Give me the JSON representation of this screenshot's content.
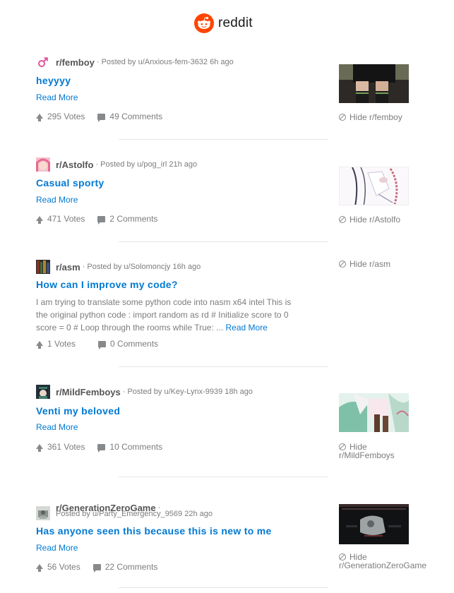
{
  "brand": {
    "name": "reddit",
    "icon": "reddit-alien-icon",
    "color": "#ff4500"
  },
  "posts": [
    {
      "subreddit": "r/femboy",
      "icon": "male-symbol-icon",
      "posted_by": "· Posted by u/Anxious-fem-3632 6h ago",
      "title": "heyyyy",
      "read_more": "Read More",
      "votes": "295 Votes",
      "comments": "49 Comments",
      "hide_label": "Hide r/femboy"
    },
    {
      "subreddit": "r/Astolfo",
      "icon": "astolfo-avatar-icon",
      "posted_by": "· Posted by u/pog_irl 21h ago",
      "title": "Casual sporty",
      "read_more": "Read More",
      "votes": "471 Votes",
      "comments": "2 Comments",
      "hide_label": "Hide r/Astolfo"
    },
    {
      "subreddit": "r/asm",
      "icon": "asm-avatar-icon",
      "posted_by": "· Posted by u/Solomoncjy 16h ago",
      "title": "How can I improve my code?",
      "excerpt": "I am trying to translate some python code into nasm x64 intel This is the original python code : import random as rd # Initialize score to 0 score = 0 # Loop through the rooms while True: ...",
      "read_more": "Read More",
      "votes": "1 Votes",
      "comments": "0 Comments",
      "hide_label": "Hide r/asm"
    },
    {
      "subreddit": "r/MildFemboys",
      "icon": "mildfemboys-avatar-icon",
      "posted_by": "· Posted by u/Key-Lynx-9939 18h ago",
      "title": "Venti my beloved",
      "read_more": "Read More",
      "votes": "361 Votes",
      "comments": "10 Comments",
      "hide_line1": "Hide",
      "hide_line2": "r/MildFemboys"
    },
    {
      "subreddit": "r/GenerationZeroGame",
      "icon": "generationzero-avatar-icon",
      "posted_by_dot": "·",
      "posted_by": "Posted by u/Party_Emergency_9569 22h ago",
      "title": "Has anyone seen this because this is new to me",
      "read_more": "Read More",
      "votes": "56 Votes",
      "comments": "22 Comments",
      "hide_line1": "Hide",
      "hide_line2": "r/GenerationZeroGame"
    }
  ]
}
